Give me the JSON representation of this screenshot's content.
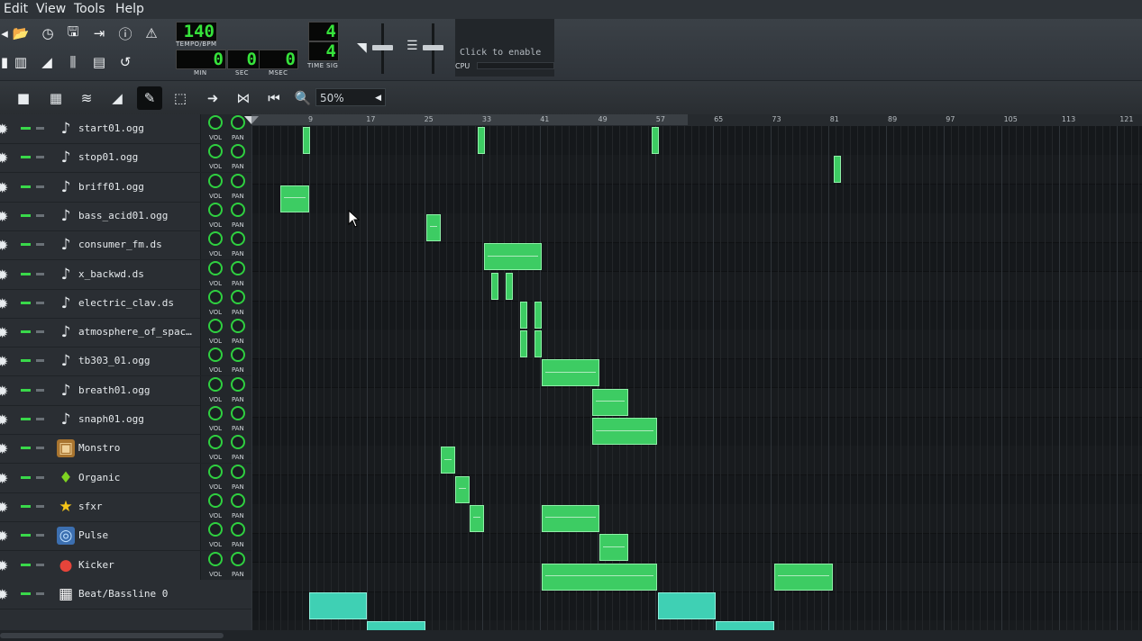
{
  "menu": [
    "Edit",
    "View",
    "Tools",
    "Help"
  ],
  "toolbar": {
    "tempo_value": "140",
    "tempo_caption": "TEMPO/BPM",
    "min_value": "0",
    "min_caption": "MIN",
    "sec_value": "0",
    "sec_caption": "SEC",
    "msec_value": "0",
    "msec_caption": "MSEC",
    "time_sig_num": "4",
    "time_sig_den": "4",
    "time_sig_caption": "TIME SIG",
    "cpu_text": "Click to enable",
    "cpu_caption": "CPU"
  },
  "edit_toolbar": {
    "zoom": "50%"
  },
  "timeline": [
    "9",
    "17",
    "25",
    "33",
    "41",
    "49",
    "57",
    "65",
    "73",
    "81",
    "89",
    "97",
    "105",
    "113",
    "121"
  ],
  "tracks": [
    {
      "name": "start01.ogg",
      "icon": "sample-note-icon",
      "vol": "VOL",
      "pan": "PAN"
    },
    {
      "name": "stop01.ogg",
      "icon": "sample-note-icon",
      "vol": "VOL",
      "pan": "PAN"
    },
    {
      "name": "briff01.ogg",
      "icon": "sample-note-icon",
      "vol": "VOL",
      "pan": "PAN"
    },
    {
      "name": "bass_acid01.ogg",
      "icon": "sample-note-icon",
      "vol": "VOL",
      "pan": "PAN"
    },
    {
      "name": "consumer_fm.ds",
      "icon": "sample-note-icon",
      "vol": "VOL",
      "pan": "PAN"
    },
    {
      "name": "x_backwd.ds",
      "icon": "sample-note-icon",
      "vol": "VOL",
      "pan": "PAN"
    },
    {
      "name": "electric_clav.ds",
      "icon": "sample-note-icon",
      "vol": "VOL",
      "pan": "PAN"
    },
    {
      "name": "atmosphere_of_spac…",
      "icon": "sample-note-icon",
      "vol": "VOL",
      "pan": "PAN"
    },
    {
      "name": "tb303_01.ogg",
      "icon": "sample-note-icon",
      "vol": "VOL",
      "pan": "PAN"
    },
    {
      "name": "breath01.ogg",
      "icon": "sample-note-icon",
      "vol": "VOL",
      "pan": "PAN"
    },
    {
      "name": "snaph01.ogg",
      "icon": "sample-note-icon",
      "vol": "VOL",
      "pan": "PAN"
    },
    {
      "name": "Monstro",
      "icon": "monstro-icon",
      "vol": "VOL",
      "pan": "PAN"
    },
    {
      "name": "Organic",
      "icon": "organic-icon",
      "vol": "VOL",
      "pan": "PAN"
    },
    {
      "name": "sfxr",
      "icon": "sfxr-star-icon",
      "vol": "VOL",
      "pan": "PAN"
    },
    {
      "name": "Pulse",
      "icon": "pulse-icon",
      "vol": "VOL",
      "pan": "PAN"
    },
    {
      "name": "Kicker",
      "icon": "kicker-ball-icon",
      "vol": "VOL",
      "pan": "PAN"
    },
    {
      "name": "Beat/Bassline 0",
      "icon": "beat-bassline-icon"
    }
  ],
  "colors": {
    "pattern_green": "#3dcc63",
    "pattern_teal": "#3fd0b4",
    "lcd_green": "#36e33b"
  }
}
